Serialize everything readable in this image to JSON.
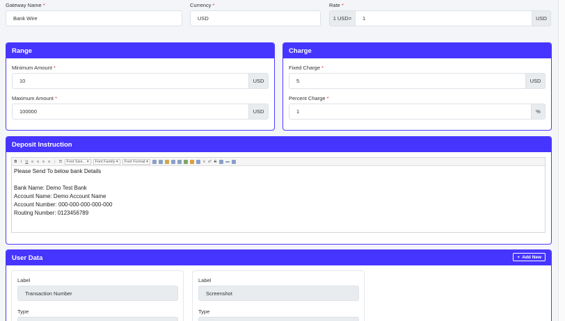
{
  "top": {
    "gateway_label": "Gateway Name",
    "gateway_value": "Bank Wire",
    "currency_label": "Currency",
    "currency_value": "USD",
    "rate_label": "Rate",
    "rate_prefix": "1 USD=",
    "rate_value": "1",
    "rate_suffix": "USD",
    "required_mark": "*"
  },
  "range": {
    "title": "Range",
    "min_label": "Minimum Amount",
    "min_value": "10",
    "min_unit": "USD",
    "max_label": "Maximum Amount",
    "max_value": "100000",
    "max_unit": "USD"
  },
  "charge": {
    "title": "Charge",
    "fixed_label": "Fixed Charge",
    "fixed_value": "5",
    "fixed_unit": "USD",
    "percent_label": "Percent Charge",
    "percent_value": "1",
    "percent_unit": "%"
  },
  "deposit": {
    "title": "Deposit Instruction",
    "toolbar": {
      "bold": "B",
      "italic": "I",
      "underline": "U",
      "font_size": "Font Size...",
      "font_family": "Font Family",
      "font_format": "Font Format",
      "subscript": "x",
      "superscript": "x²"
    },
    "lines": [
      "Please Send To below bank Details",
      "",
      "Bank Name: Demo Test Bank",
      "Account Name: Demo Account Name",
      "Account Number: 000-000-000-000-000",
      "Routing Number: 0123456789"
    ]
  },
  "user_data": {
    "title": "User Data",
    "add_new": "Add New",
    "add_icon": "+",
    "fields": [
      {
        "label_caption": "Label",
        "label_value": "Transaction Number",
        "type_caption": "Type"
      },
      {
        "label_caption": "Label",
        "label_value": "Screenshot",
        "type_caption": "Type"
      }
    ]
  },
  "colors": {
    "accent": "#4634ff",
    "required": "#e3342f"
  }
}
